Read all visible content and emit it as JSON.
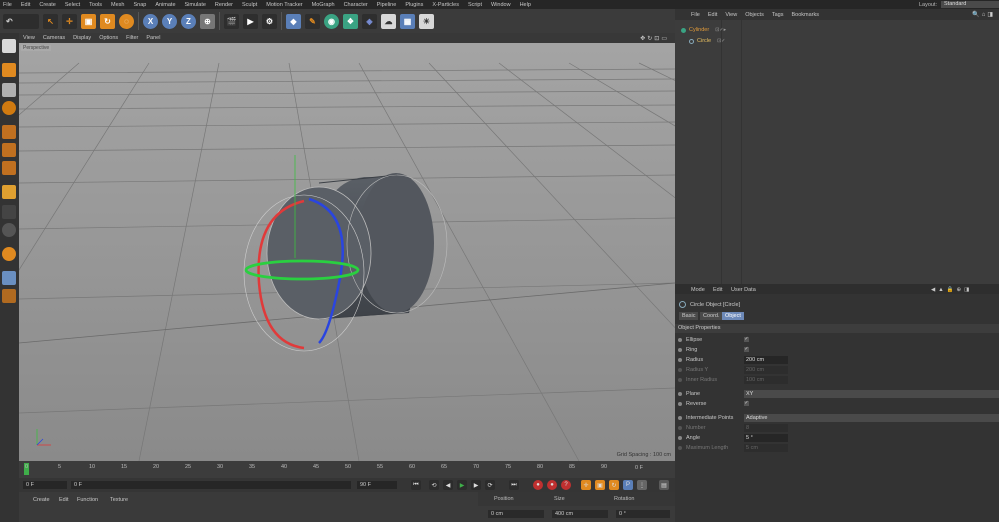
{
  "menubar": {
    "items": [
      "File",
      "Edit",
      "Create",
      "Select",
      "Tools",
      "Mesh",
      "Snap",
      "Animate",
      "Simulate",
      "Render",
      "Sculpt",
      "Motion Tracker",
      "MoGraph",
      "Character",
      "Pipeline",
      "Plugins",
      "X-Particles",
      "Script",
      "Window",
      "Help"
    ],
    "layout_label": "Layout:",
    "layout_value": "Standard"
  },
  "toolbar": {
    "axis_x": "X",
    "axis_y": "Y",
    "axis_z": "Z"
  },
  "viewport": {
    "menu": [
      "View",
      "Cameras",
      "Display",
      "Options",
      "Filter",
      "Panel"
    ],
    "label": "Perspective",
    "grid_spacing": "Grid Spacing : 100 cm"
  },
  "timeline": {
    "ticks": [
      "0",
      "5",
      "10",
      "15",
      "20",
      "25",
      "30",
      "35",
      "40",
      "45",
      "50",
      "55",
      "60",
      "65",
      "70",
      "75",
      "80",
      "85",
      "90"
    ],
    "end_frame": "0 F"
  },
  "transport": {
    "current_frame": "0 F",
    "start_frame": "0 F",
    "end_frame": "90 F"
  },
  "material": {
    "menu": [
      "Create",
      "Edit",
      "Function",
      "Texture"
    ]
  },
  "coordinates": {
    "headers": [
      "Position",
      "Size",
      "Rotation"
    ],
    "values": [
      "0 cm",
      "400 cm",
      "0 °"
    ]
  },
  "object_manager": {
    "menu": [
      "File",
      "Edit",
      "View",
      "Objects",
      "Tags",
      "Bookmarks"
    ],
    "objects": [
      {
        "name": "Cylinder",
        "color": "#e09a3a"
      },
      {
        "name": "Circle",
        "color": "#e8c060"
      }
    ]
  },
  "attributes": {
    "menu": [
      "Mode",
      "Edit",
      "User Data"
    ],
    "title": "Circle Object [Circle]",
    "tabs": [
      "Basic",
      "Coord.",
      "Object"
    ],
    "active_tab": "Object",
    "section": "Object Properties",
    "props": {
      "ellipse": "Ellipse",
      "ring": "Ring",
      "radius": "Radius",
      "radius_val": "200 cm",
      "radius_y": "Radius Y",
      "radius_y_val": "200 cm",
      "inner_radius": "Inner Radius",
      "inner_radius_val": "100 cm",
      "plane": "Plane",
      "plane_val": "XY",
      "reverse": "Reverse",
      "intermediate": "Intermediate Points",
      "intermediate_val": "Adaptive",
      "number": "Number",
      "number_val": "8",
      "angle": "Angle",
      "angle_val": "5 °",
      "max_length": "Maximum Length",
      "max_length_val": "5 cm"
    }
  }
}
